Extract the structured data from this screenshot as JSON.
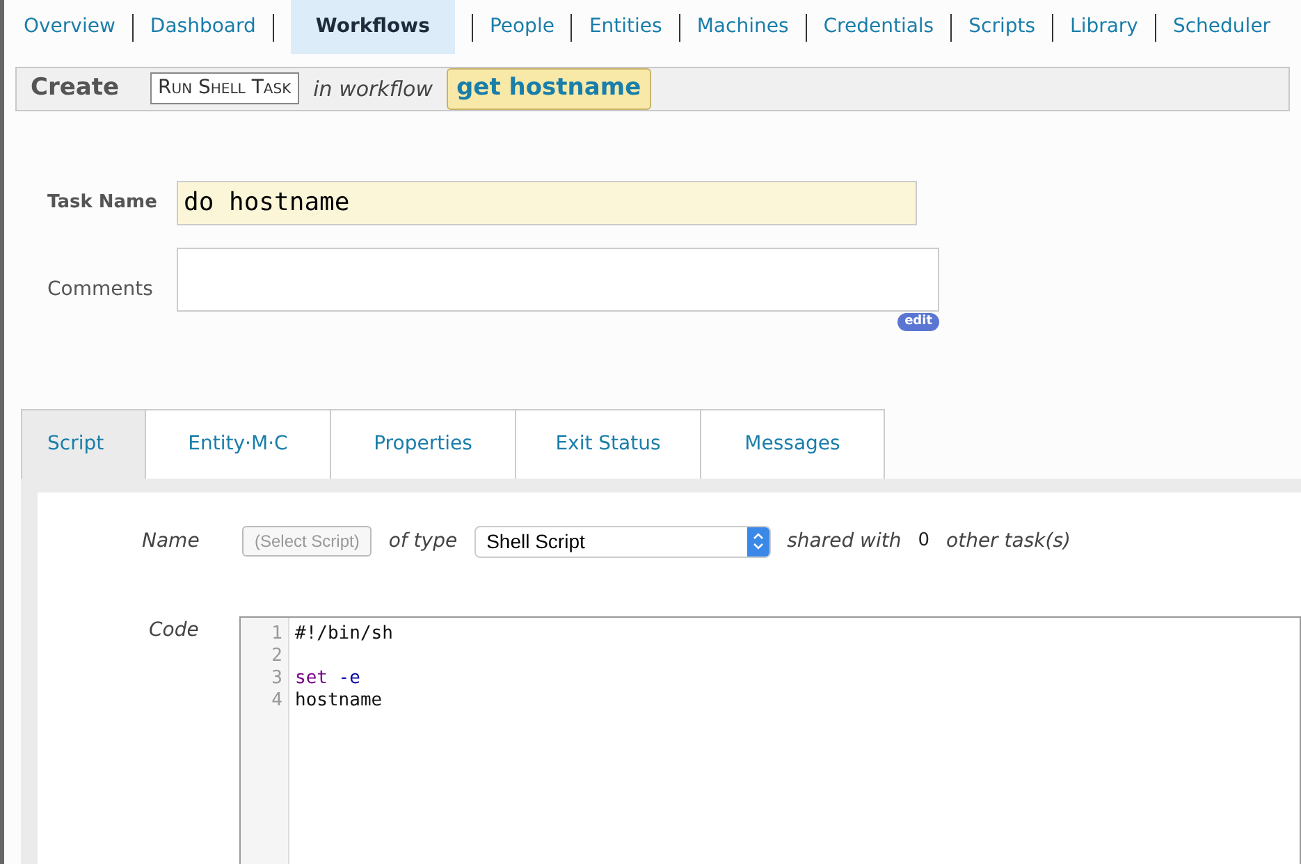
{
  "nav": [
    {
      "label": "Overview",
      "selected": false
    },
    {
      "label": "Dashboard",
      "selected": false
    },
    {
      "label": "Workflows",
      "selected": true
    },
    {
      "label": "People",
      "selected": false
    },
    {
      "label": "Entities",
      "selected": false
    },
    {
      "label": "Machines",
      "selected": false
    },
    {
      "label": "Credentials",
      "selected": false
    },
    {
      "label": "Scripts",
      "selected": false
    },
    {
      "label": "Library",
      "selected": false
    },
    {
      "label": "Scheduler",
      "selected": false
    }
  ],
  "header": {
    "title": "Create",
    "task_type": "Run Shell Task",
    "connector": "in workflow",
    "workflow": "get hostname"
  },
  "form": {
    "task_name_label": "Task Name",
    "task_name": "do hostname",
    "comments_label": "Comments",
    "edit_button": "edit"
  },
  "tabs": [
    {
      "label": "Script",
      "selected": true
    },
    {
      "label": "Entity·M·C",
      "selected": false
    },
    {
      "label": "Properties",
      "selected": false
    },
    {
      "label": "Exit Status",
      "selected": false
    },
    {
      "label": "Messages",
      "selected": false
    }
  ],
  "script": {
    "name_label": "Name",
    "select_button": "(Select Script)",
    "type_label": "of type",
    "type_value": "Shell Script",
    "shared_label": "shared with",
    "shared_count": "0",
    "shared_suffix": "other task(s)",
    "code_label": "Code",
    "lines": [
      {
        "number": "1",
        "tokens": [
          {
            "kind": "plain",
            "text": "#!/bin/sh"
          }
        ]
      },
      {
        "number": "2"
      },
      {
        "number": "3",
        "tokens": [
          {
            "kind": "keyword",
            "text": "set"
          },
          {
            "kind": "flag",
            "text": "-e"
          }
        ]
      },
      {
        "number": "4",
        "tokens": [
          {
            "kind": "plain",
            "text": "hostname"
          }
        ]
      }
    ]
  }
}
